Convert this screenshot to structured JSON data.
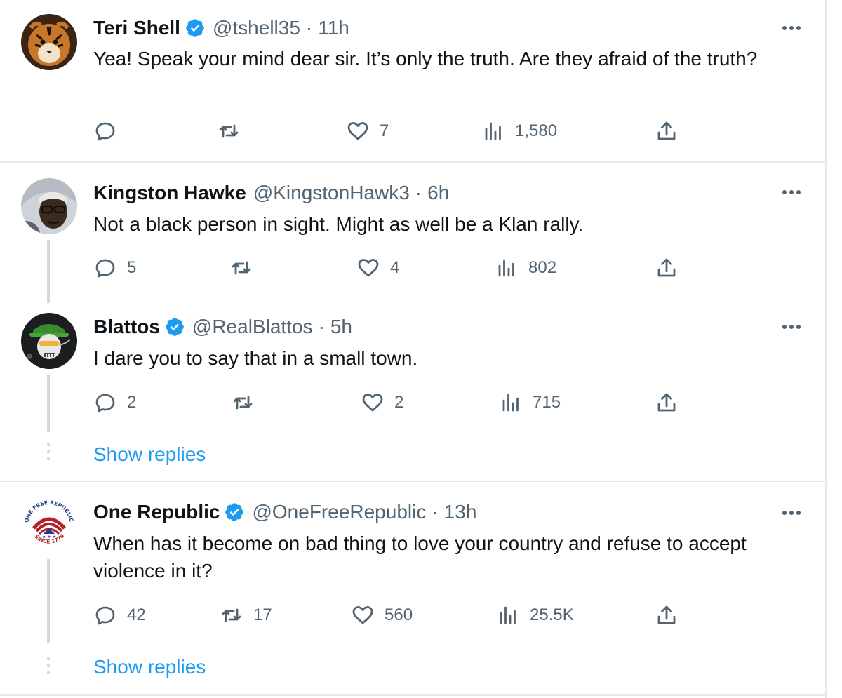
{
  "colors": {
    "accent": "#1d9bf0",
    "text": "#0f1419",
    "secondary": "#536471",
    "separator": "#e7e9ea",
    "thread": "#cfd9de"
  },
  "tweets": [
    {
      "name": "Teri Shell",
      "verified": true,
      "handle": "@tshell35",
      "sep": "·",
      "time": "11h",
      "text": "Yea! Speak your mind dear sir. It’s only the truth. Are they afraid of the truth?",
      "replies": "",
      "retweets": "",
      "likes": "7",
      "views": "1,580",
      "avatar": "tiger-avatar"
    },
    {
      "name": "Kingston Hawke",
      "verified": false,
      "handle": "@KingstonHawk3",
      "sep": "·",
      "time": "6h",
      "text": "Not a black person in sight. Might as well be a Klan rally.",
      "replies": "5",
      "retweets": "",
      "likes": "4",
      "views": "802",
      "avatar": "person-avatar"
    },
    {
      "name": "Blattos",
      "verified": true,
      "handle": "@RealBlattos",
      "sep": "·",
      "time": "5h",
      "text": "I dare you to say that in a small town.",
      "replies": "2",
      "retweets": "",
      "likes": "2",
      "views": "715",
      "avatar": "skull-avatar",
      "show_replies": "Show replies"
    },
    {
      "name": "One Republic",
      "verified": true,
      "handle": "@OneFreeRepublic",
      "sep": "·",
      "time": "13h",
      "text": "When has it become on bad thing to love your country and refuse to accept violence in it?",
      "replies": "42",
      "retweets": "17",
      "likes": "560",
      "views": "25.5K",
      "avatar": "republic-logo-avatar",
      "logo_text": {
        "top": "ONE FREE REPUBLIC",
        "bottom": "SINCE 1776"
      },
      "show_replies": "Show replies"
    }
  ]
}
